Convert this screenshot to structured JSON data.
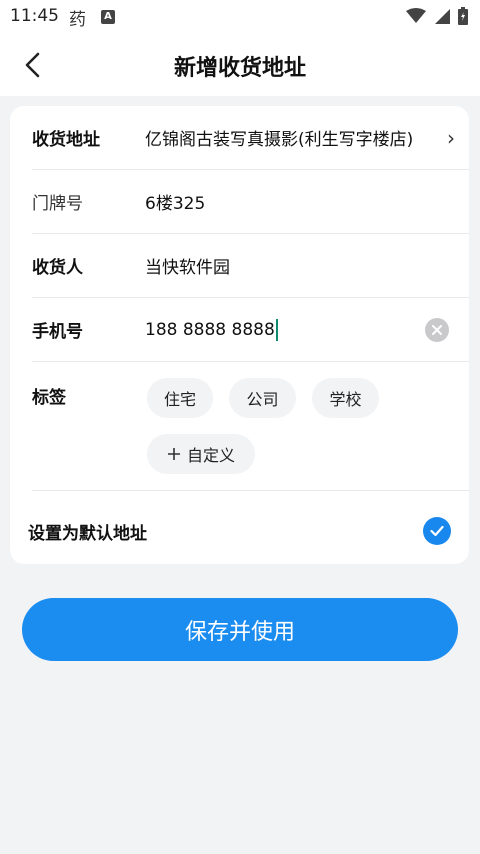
{
  "status_bar": {
    "time": "11:45",
    "app_glyph": "药",
    "notif_letter": "A",
    "icons": [
      "wifi-icon",
      "cell-signal-icon",
      "battery-icon"
    ]
  },
  "header": {
    "title": "新增收货地址",
    "back_icon": "chevron-left-icon"
  },
  "form": {
    "address": {
      "label": "收货地址",
      "value": "亿锦阁古装写真摄影(利生写字楼店)",
      "chevron": "›"
    },
    "doorplate": {
      "label": "门牌号",
      "value": "6楼325"
    },
    "receiver": {
      "label": "收货人",
      "value": "当快软件园"
    },
    "phone": {
      "label": "手机号",
      "value": "188 8888 8888"
    },
    "tags": {
      "label": "标签",
      "items": [
        "住宅",
        "公司",
        "学校"
      ],
      "custom": "自定义",
      "custom_icon": "plus-icon"
    },
    "default": {
      "label": "设置为默认地址",
      "checked": true
    }
  },
  "actions": {
    "save_label": "保存并使用"
  },
  "colors": {
    "accent": "#1b8cf0",
    "caret": "#0f8a6c",
    "background": "#f2f3f5"
  }
}
